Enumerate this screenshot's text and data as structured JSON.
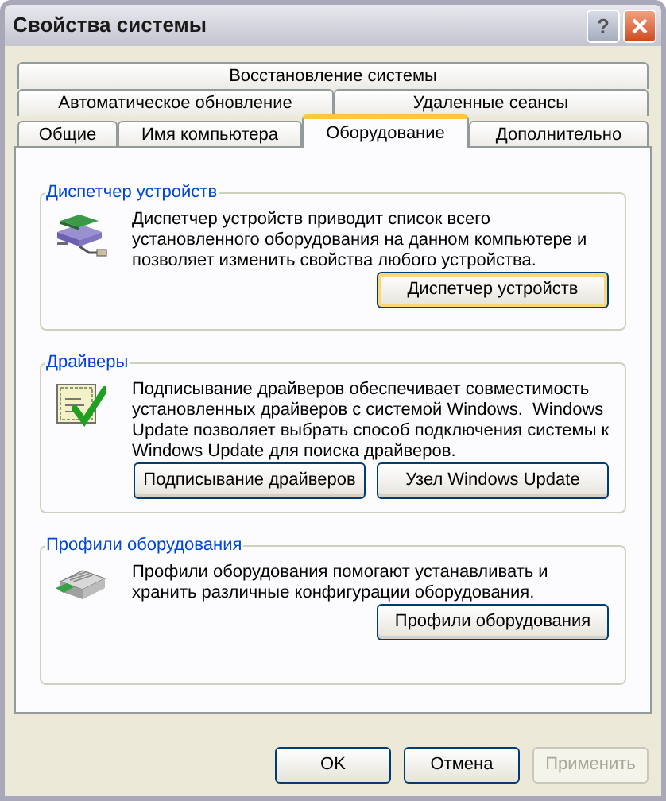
{
  "window": {
    "title": "Свойства системы",
    "help": "?"
  },
  "tab_rows": [
    [
      {
        "label": "Восстановление системы",
        "selected": false
      }
    ],
    [
      {
        "label": "Автоматическое обновление",
        "selected": false
      },
      {
        "label": "Удаленные сеансы",
        "selected": false
      }
    ],
    [
      {
        "label": "Общие",
        "selected": false
      },
      {
        "label": "Имя компьютера",
        "selected": false
      },
      {
        "label": "Оборудование",
        "selected": true
      },
      {
        "label": "Дополнительно",
        "selected": false
      }
    ]
  ],
  "groups": [
    {
      "title": "Диспетчер устройств",
      "description": "Диспетчер устройств приводит список всего установленного оборудования на данном компьютере и позволяет изменить свойства любого устройства.",
      "buttons": [
        {
          "label": "Диспетчер устройств",
          "default": true
        }
      ]
    },
    {
      "title": "Драйверы",
      "description": "Подписывание драйверов обеспечивает совместимость установленных драйверов с системой Windows.  Windows Update позволяет выбрать способ подключения системы к Windows Update для поиска драйверов.",
      "buttons": [
        {
          "label": "Подписывание драйверов",
          "default": false
        },
        {
          "label": "Узел Windows Update",
          "default": false
        }
      ]
    },
    {
      "title": "Профили оборудования",
      "description": "Профили оборудования помогают устанавливать и хранить различные конфигурации оборудования.",
      "buttons": [
        {
          "label": "Профили оборудования",
          "default": false
        }
      ]
    }
  ],
  "dialog_buttons": [
    {
      "label": "OK",
      "disabled": false
    },
    {
      "label": "Отмена",
      "disabled": false
    },
    {
      "label": "Применить",
      "disabled": true
    }
  ]
}
